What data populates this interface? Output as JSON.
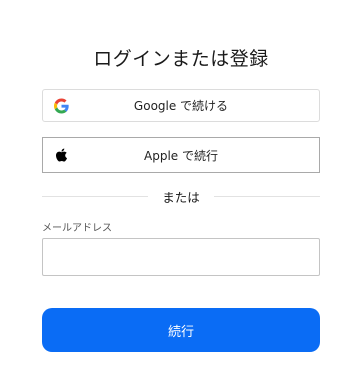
{
  "page": {
    "title": "ログインまたは登録"
  },
  "social": {
    "google": {
      "label": "Google で続ける",
      "icon": "google-logo-icon"
    },
    "apple": {
      "label": "Apple で続行",
      "icon": "apple-logo-icon"
    }
  },
  "divider": {
    "text": "または"
  },
  "email": {
    "label": "メールアドレス",
    "value": "",
    "placeholder": ""
  },
  "continue_button": {
    "label": "続行"
  },
  "colors": {
    "primary": "#0a6cf5",
    "google_blue": "#4285F4",
    "google_red": "#EA4335",
    "google_yellow": "#FBBC05",
    "google_green": "#34A853"
  }
}
